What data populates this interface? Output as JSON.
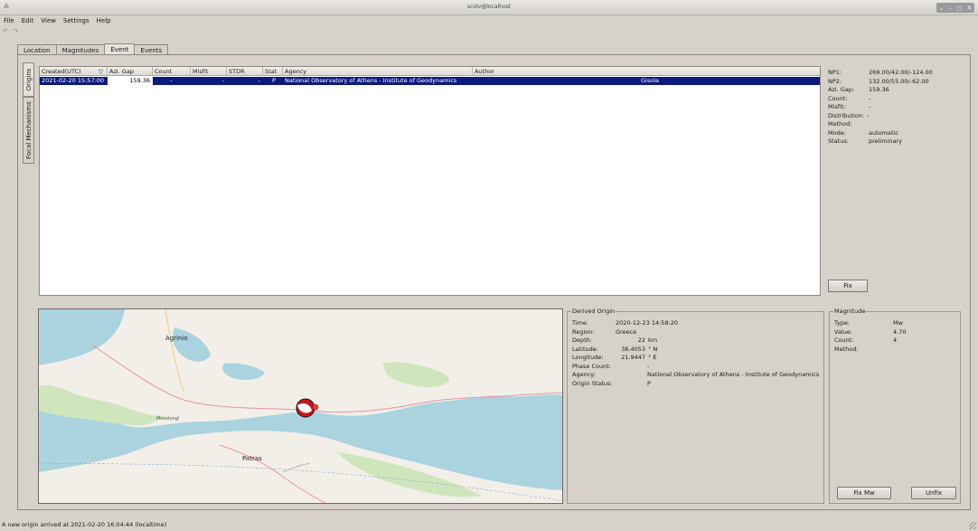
{
  "window": {
    "title": "scolv@localhost"
  },
  "menu": [
    "File",
    "Edit",
    "View",
    "Settings",
    "Help"
  ],
  "tabs": [
    {
      "label": "Location"
    },
    {
      "label": "Magnitudes"
    },
    {
      "label": "Event",
      "active": true
    },
    {
      "label": "Events"
    }
  ],
  "side_tabs": [
    {
      "label": "Origins",
      "active": true
    },
    {
      "label": "Focal Mechanisms"
    }
  ],
  "grid": {
    "columns": [
      "Created(UTC)",
      "Azi. Gap",
      "Count",
      "Misfit",
      "STDR",
      "Stat",
      "Agency",
      "Author"
    ],
    "rows": [
      [
        "2021-02-20 15:57:00",
        "159.36",
        "-",
        "-",
        "-",
        "P",
        "National Observatory of Athens - Institute of Geodynamics",
        "Gisola"
      ]
    ],
    "sort_icon": "sort-indicator-icon"
  },
  "focal_info": [
    {
      "key": "NP1:",
      "value": "269.00/42.00/-124.00"
    },
    {
      "key": "NP2:",
      "value": "132.00/55.00/-62.00"
    },
    {
      "key": "Azi. Gap:",
      "value": "159.36"
    },
    {
      "key": "Count:",
      "value": "-"
    },
    {
      "key": "Misfit:",
      "value": "-"
    },
    {
      "key": "Distribution:",
      "value": "-"
    },
    {
      "key": "Method:",
      "value": ""
    },
    {
      "key": "Mode:",
      "value": "automatic"
    },
    {
      "key": "Status:",
      "value": "preliminary"
    }
  ],
  "buttons": {
    "fix": "Fix",
    "fix_mw": "Fix Mw",
    "unfix": "Unfix"
  },
  "map": {
    "labels": {
      "agrinio": "Agrinio",
      "patras": "Patras",
      "mesolongi": "Mesolongi"
    },
    "colors": {
      "sea": "#aad3df",
      "land": "#f2efe9",
      "green": "#cfe6bd",
      "event": "#c8161d"
    }
  },
  "derived_origin": {
    "title": "Derived Origin",
    "fields": [
      {
        "key": "Time:",
        "value": "2020-12-23 14:58:20"
      },
      {
        "key": "Region:",
        "value": "Greece"
      },
      {
        "key": "Depth:",
        "value": "22",
        "unit": "km"
      },
      {
        "key": "Latitude:",
        "value": "38.4053",
        "unit": "° N"
      },
      {
        "key": "Longitude:",
        "value": "21.9447",
        "unit": "° E"
      },
      {
        "key": "Phase Count:",
        "value": "-"
      },
      {
        "key": "Agency:",
        "value": "National Observatory of Athens - Institute of Geodynamics"
      },
      {
        "key": "Origin Status:",
        "value": "P"
      }
    ]
  },
  "magnitude": {
    "title": "Magnitude",
    "fields": [
      {
        "key": "Type:",
        "value": "Mw"
      },
      {
        "key": "Value:",
        "value": "4.70"
      },
      {
        "key": "Count:",
        "value": "4"
      },
      {
        "key": "Method:",
        "value": ""
      }
    ]
  },
  "status": "A new origin arrived at 2021-02-20 16:04:44 (localtime)"
}
